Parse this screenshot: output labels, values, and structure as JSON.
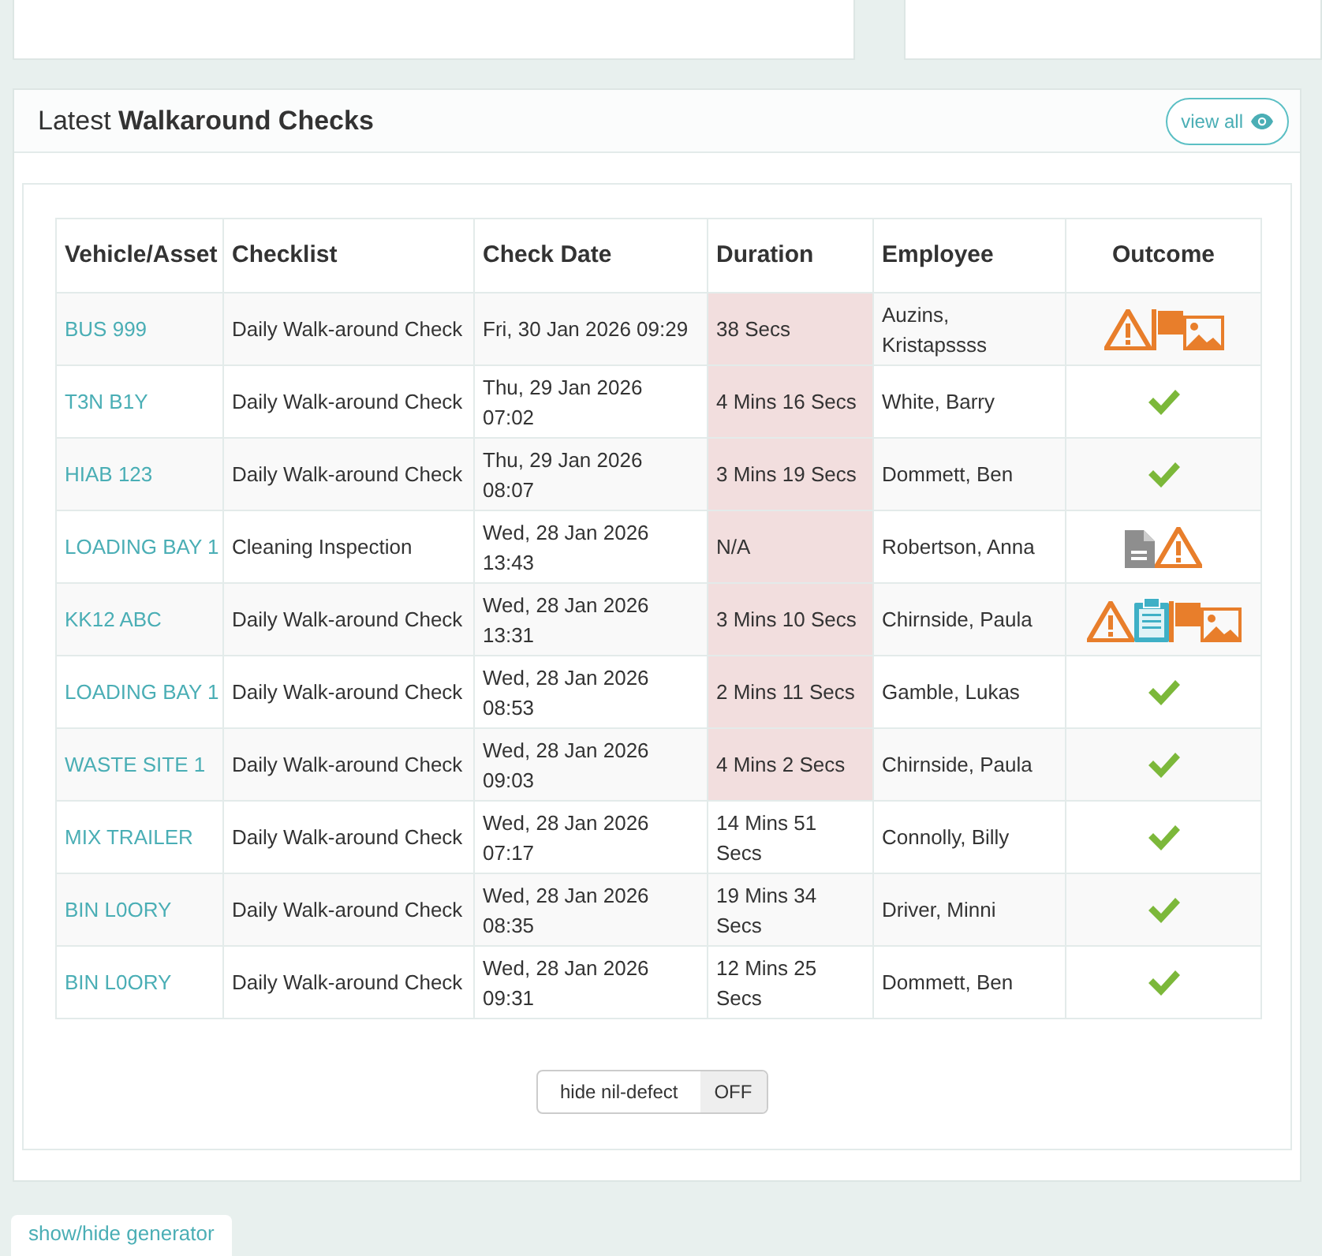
{
  "panel": {
    "title_prefix": "Latest",
    "title_bold": "Walkaround Checks",
    "view_all": "view all"
  },
  "table": {
    "columns": [
      "Vehicle/Asset",
      "Checklist",
      "Check Date",
      "Duration",
      "Employee",
      "Outcome"
    ],
    "rows": [
      {
        "asset": "BUS 999",
        "checklist": "Daily Walk-around Check",
        "date": "Fri, 30 Jan 2026 09:29",
        "duration": "38 Secs",
        "flagged": true,
        "employee": "Auzins, Kristapssss",
        "outcome": [
          {
            "kind": "warning"
          },
          {
            "kind": "flag"
          },
          {
            "kind": "image"
          }
        ]
      },
      {
        "asset": "T3N B1Y",
        "checklist": "Daily Walk-around Check",
        "date": "Thu, 29 Jan 2026 07:02",
        "duration": "4 Mins 16 Secs",
        "flagged": true,
        "employee": "White, Barry",
        "outcome": [
          {
            "kind": "check"
          }
        ]
      },
      {
        "asset": "HIAB 123",
        "checklist": "Daily Walk-around Check",
        "date": "Thu, 29 Jan 2026 08:07",
        "duration": "3 Mins 19 Secs",
        "flagged": true,
        "employee": "Dommett, Ben",
        "outcome": [
          {
            "kind": "check"
          }
        ]
      },
      {
        "asset": "LOADING BAY 1",
        "checklist": "Cleaning Inspection",
        "date": "Wed, 28 Jan 2026 13:43",
        "duration": "N/A",
        "flagged": true,
        "employee": "Robertson, Anna",
        "outcome": [
          {
            "kind": "document"
          },
          {
            "kind": "warning"
          }
        ]
      },
      {
        "asset": "KK12 ABC",
        "checklist": "Daily Walk-around Check",
        "date": "Wed, 28 Jan 2026 13:31",
        "duration": "3 Mins 10 Secs",
        "flagged": true,
        "employee": "Chirnside, Paula",
        "outcome": [
          {
            "kind": "warning"
          },
          {
            "kind": "clipboard"
          },
          {
            "kind": "flag"
          },
          {
            "kind": "image"
          }
        ]
      },
      {
        "asset": "LOADING BAY 1",
        "checklist": "Daily Walk-around Check",
        "date": "Wed, 28 Jan 2026 08:53",
        "duration": "2 Mins 11 Secs",
        "flagged": true,
        "employee": "Gamble, Lukas",
        "outcome": [
          {
            "kind": "check"
          }
        ]
      },
      {
        "asset": "WASTE SITE 1",
        "checklist": "Daily Walk-around Check",
        "date": "Wed, 28 Jan 2026 09:03",
        "duration": "4 Mins 2 Secs",
        "flagged": true,
        "employee": "Chirnside, Paula",
        "outcome": [
          {
            "kind": "check"
          }
        ]
      },
      {
        "asset": "MIX TRAILER",
        "checklist": "Daily Walk-around Check",
        "date": "Wed, 28 Jan 2026 07:17",
        "duration": "14 Mins 51 Secs",
        "flagged": false,
        "employee": "Connolly, Billy",
        "outcome": [
          {
            "kind": "check"
          }
        ]
      },
      {
        "asset": "BIN L0ORY",
        "checklist": "Daily Walk-around Check",
        "date": "Wed, 28 Jan 2026 08:35",
        "duration": "19 Mins 34 Secs",
        "flagged": false,
        "employee": "Driver, Minni",
        "outcome": [
          {
            "kind": "check"
          }
        ]
      },
      {
        "asset": "BIN L0ORY",
        "checklist": "Daily Walk-around Check",
        "date": "Wed, 28 Jan 2026 09:31",
        "duration": "12 Mins 25 Secs",
        "flagged": false,
        "employee": "Dommett, Ben",
        "outcome": [
          {
            "kind": "check"
          }
        ]
      }
    ]
  },
  "toggle": {
    "label": "hide nil-defect",
    "state": "OFF",
    "on": false
  },
  "generator_button": "show/hide generator"
}
